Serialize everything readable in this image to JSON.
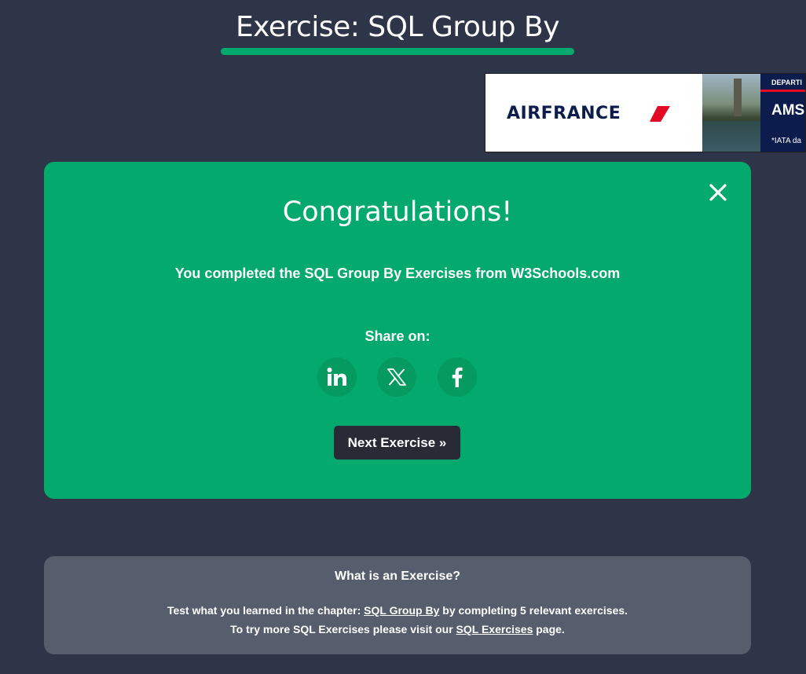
{
  "header": {
    "title": "Exercise: SQL Group By",
    "accent_color": "#04aa6d"
  },
  "ad": {
    "logo_text": "AIRFRANCE",
    "departure_text": "DEPARTI",
    "city_text": "AMS",
    "note_text": "*IATA da",
    "brand_color": "#0b1c4d",
    "accent_color": "#e30b23"
  },
  "congrats": {
    "title": "Congratulations!",
    "message": "You completed the SQL Group By Exercises from W3Schools.com",
    "share_label": "Share on:",
    "share_icons": [
      "linkedin-icon",
      "x-icon",
      "facebook-icon"
    ],
    "next_label": "Next Exercise »",
    "close_icon": "close-icon",
    "background_color": "#04aa6d",
    "button_color": "#282a35"
  },
  "info": {
    "heading": "What is an Exercise?",
    "line1_prefix": "Test what you learned in the chapter: ",
    "line1_link": "SQL Group By",
    "line1_suffix": " by completing 5 relevant exercises.",
    "line2_prefix": "To try more SQL Exercises please visit our ",
    "line2_link": "SQL Exercises",
    "line2_suffix": " page."
  }
}
